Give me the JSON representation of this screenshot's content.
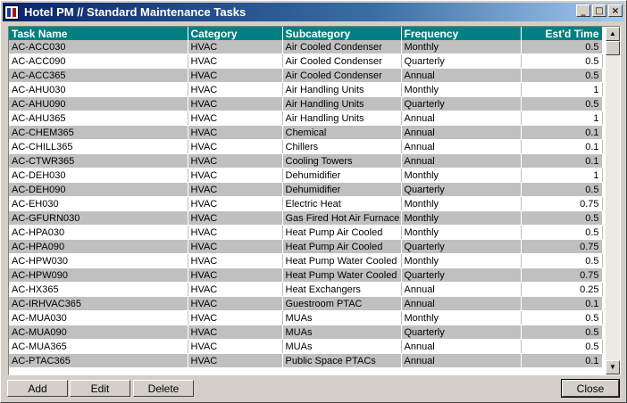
{
  "window": {
    "title": "Hotel PM // Standard Maintenance Tasks"
  },
  "columns": [
    "Task Name",
    "Category",
    "Subcategory",
    "Frequency",
    "Est'd Time"
  ],
  "rows": [
    [
      "AC-ACC030",
      "HVAC",
      "Air Cooled Condenser",
      "Monthly",
      "0.5"
    ],
    [
      "AC-ACC090",
      "HVAC",
      "Air Cooled Condenser",
      "Quarterly",
      "0.5"
    ],
    [
      "AC-ACC365",
      "HVAC",
      "Air Cooled Condenser",
      "Annual",
      "0.5"
    ],
    [
      "AC-AHU030",
      "HVAC",
      "Air Handling Units",
      "Monthly",
      "1"
    ],
    [
      "AC-AHU090",
      "HVAC",
      "Air Handling Units",
      "Quarterly",
      "0.5"
    ],
    [
      "AC-AHU365",
      "HVAC",
      "Air Handling Units",
      "Annual",
      "1"
    ],
    [
      "AC-CHEM365",
      "HVAC",
      "Chemical",
      "Annual",
      "0.1"
    ],
    [
      "AC-CHILL365",
      "HVAC",
      "Chillers",
      "Annual",
      "0.1"
    ],
    [
      "AC-CTWR365",
      "HVAC",
      "Cooling Towers",
      "Annual",
      "0.1"
    ],
    [
      "AC-DEH030",
      "HVAC",
      "Dehumidifier",
      "Monthly",
      "1"
    ],
    [
      "AC-DEH090",
      "HVAC",
      "Dehumidifier",
      "Quarterly",
      "0.5"
    ],
    [
      "AC-EH030",
      "HVAC",
      "Electric Heat",
      "Monthly",
      "0.75"
    ],
    [
      "AC-GFURN030",
      "HVAC",
      "Gas Fired Hot Air Furnace",
      "Monthly",
      "0.5"
    ],
    [
      "AC-HPA030",
      "HVAC",
      "Heat Pump Air Cooled",
      "Monthly",
      "0.5"
    ],
    [
      "AC-HPA090",
      "HVAC",
      "Heat Pump Air Cooled",
      "Quarterly",
      "0.75"
    ],
    [
      "AC-HPW030",
      "HVAC",
      "Heat Pump Water Cooled",
      "Monthly",
      "0.5"
    ],
    [
      "AC-HPW090",
      "HVAC",
      "Heat Pump Water Cooled",
      "Quarterly",
      "0.75"
    ],
    [
      "AC-HX365",
      "HVAC",
      "Heat Exchangers",
      "Annual",
      "0.25"
    ],
    [
      "AC-IRHVAC365",
      "HVAC",
      "Guestroom PTAC",
      "Annual",
      "0.1"
    ],
    [
      "AC-MUA030",
      "HVAC",
      "MUAs",
      "Monthly",
      "0.5"
    ],
    [
      "AC-MUA090",
      "HVAC",
      "MUAs",
      "Quarterly",
      "0.5"
    ],
    [
      "AC-MUA365",
      "HVAC",
      "MUAs",
      "Annual",
      "0.5"
    ],
    [
      "AC-PTAC365",
      "HVAC",
      "Public Space PTACs",
      "Annual",
      "0.1"
    ]
  ],
  "buttons": {
    "add": "Add",
    "edit": "Edit",
    "delete": "Delete",
    "close": "Close"
  }
}
